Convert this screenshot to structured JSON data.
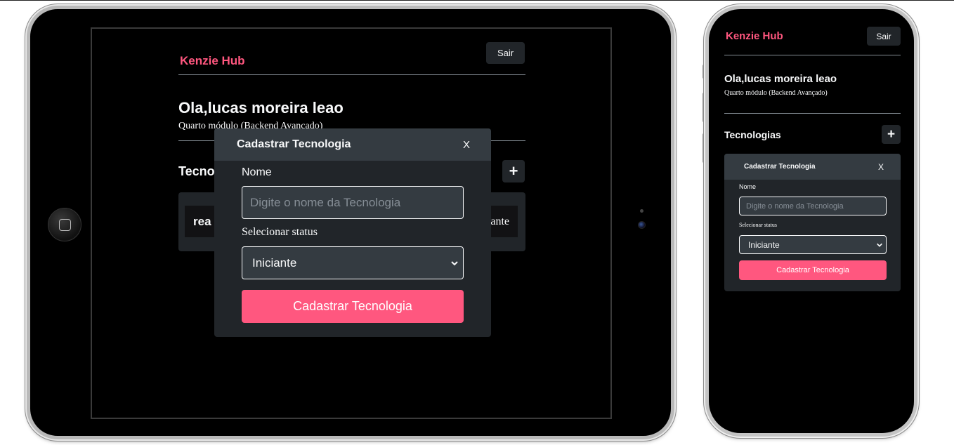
{
  "app": {
    "brand": "Kenzie Hub",
    "logout_label": "Sair",
    "greeting": "Ola,lucas moreira leao",
    "module_tablet": "Quarto módulo (Backend Avancado)",
    "module_phone": "Quarto módulo (Backend Avançado)",
    "technologies_title_partial": "Tecno",
    "technologies_title": "Tecnologias",
    "add_symbol": "+",
    "tech_items": [
      {
        "name_partial": "rea",
        "status_partial": "ante"
      }
    ]
  },
  "modal": {
    "title": "Cadastrar Tecnologia",
    "close_label": "X",
    "name_label": "Nome",
    "name_placeholder": "Digite o nome da Tecnologia",
    "status_label": "Selecionar status",
    "status_selected": "Iniciante",
    "submit_label": "Cadastrar Tecnologia"
  },
  "icons": {
    "chevron": "chevron-down-icon",
    "home": "home-button-icon",
    "camera": "camera-icon"
  },
  "colors": {
    "brand": "#ff577f",
    "background": "#000000",
    "surface": "#212529",
    "surface_alt": "#343b41",
    "text": "#f8f9fa",
    "muted": "#868e96"
  }
}
